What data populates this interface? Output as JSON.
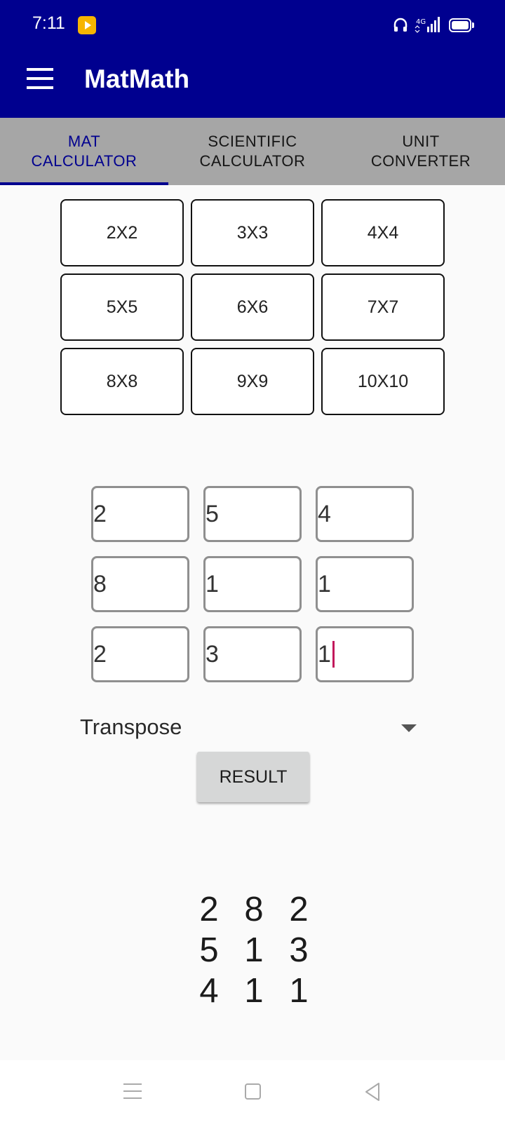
{
  "status": {
    "time": "7:11",
    "network": "4G",
    "icons": [
      "media-player-icon",
      "headset-icon",
      "signal-icon",
      "battery-icon"
    ]
  },
  "app": {
    "title": "MatMath",
    "menu_icon": "menu-icon",
    "theme_color": "#00008f"
  },
  "tabs": [
    {
      "label_line1": "MAT",
      "label_line2": "CALCULATOR",
      "active": true
    },
    {
      "label_line1": "SCIENTIFIC",
      "label_line2": "CALCULATOR",
      "active": false
    },
    {
      "label_line1": "UNIT",
      "label_line2": "CONVERTER",
      "active": false
    }
  ],
  "sizes": [
    "2X2",
    "3X3",
    "4X4",
    "5X5",
    "6X6",
    "7X7",
    "8X8",
    "9X9",
    "10X10"
  ],
  "matrix": [
    [
      "2",
      "5",
      "4"
    ],
    [
      "8",
      "1",
      "1"
    ],
    [
      "2",
      "3",
      "1"
    ]
  ],
  "operation": {
    "selected": "Transpose"
  },
  "result_button": "RESULT",
  "result": [
    [
      "2",
      "8",
      "2"
    ],
    [
      "5",
      "1",
      "3"
    ],
    [
      "4",
      "1",
      "1"
    ]
  ],
  "nav": {
    "icons": [
      "recent-apps-icon",
      "home-icon",
      "back-icon"
    ]
  }
}
